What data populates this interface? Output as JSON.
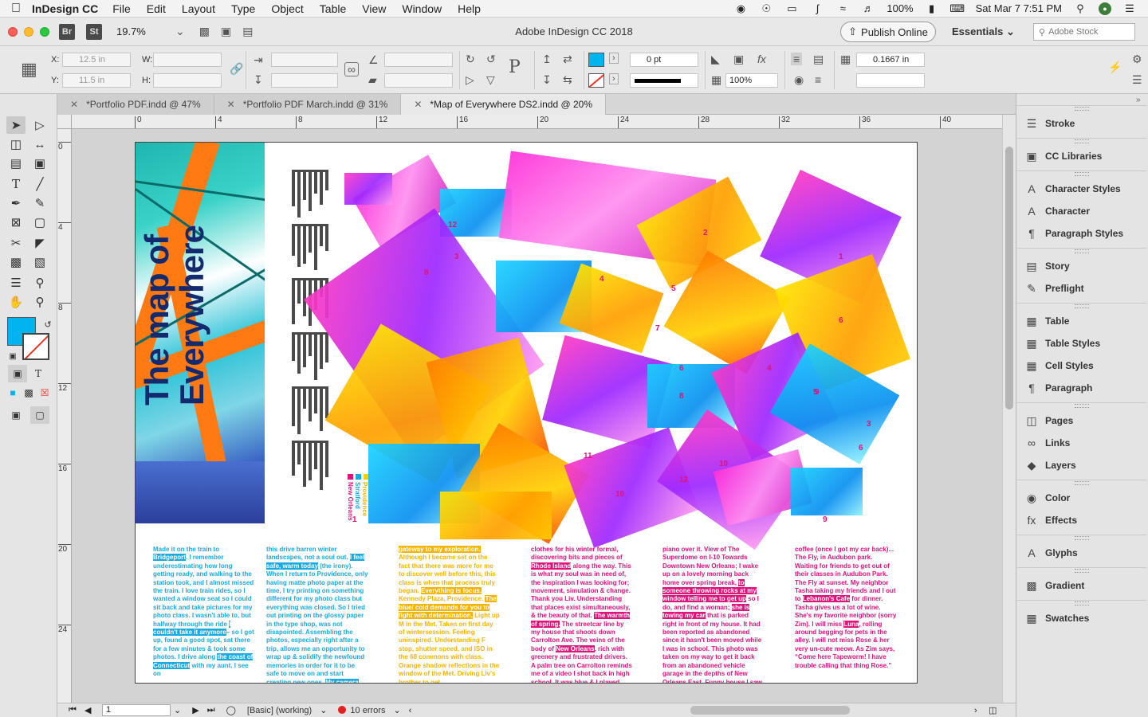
{
  "menubar": {
    "app": "InDesign CC",
    "menus": [
      "File",
      "Edit",
      "Layout",
      "Type",
      "Object",
      "Table",
      "View",
      "Window",
      "Help"
    ],
    "battery": "100%",
    "clock": "Sat Mar 7  7:51 PM"
  },
  "titlebar": {
    "title": "Adobe InDesign CC 2018",
    "zoom": "19.7%",
    "bridge": "Br",
    "stock_app": "St",
    "publish": "Publish Online",
    "workspace": "Essentials",
    "search_placeholder": "Adobe Stock"
  },
  "control": {
    "x_label": "X:",
    "x_value": "12.5 in",
    "y_label": "Y:",
    "y_value": "11.5 in",
    "w_label": "W:",
    "h_label": "H:",
    "stroke_weight": "0 pt",
    "opacity": "100%",
    "gutter": "0.1667 in"
  },
  "tabs": [
    {
      "label": "*Portfolio PDF.indd @ 47%"
    },
    {
      "label": "*Portfolio PDF March.indd @ 31%"
    },
    {
      "label": "*Map of Everywhere DS2.indd @ 20%"
    }
  ],
  "ruler": {
    "top": [
      "0",
      "4",
      "8",
      "12",
      "16",
      "20",
      "24",
      "28",
      "32",
      "36",
      "40"
    ],
    "left": [
      "0",
      "4",
      "8",
      "12",
      "16",
      "20",
      "24"
    ]
  },
  "document": {
    "cover_title_1": "The map of",
    "cover_title_2": "Everywhere",
    "legend": [
      "Providence",
      "Stratford",
      "New Orleans"
    ],
    "numbers": [
      "12",
      "3",
      "8",
      "2",
      "1",
      "4",
      "5",
      "7",
      "6",
      "4",
      "5",
      "6",
      "9",
      "11",
      "3",
      "6",
      "10",
      "12",
      "10",
      "9",
      "8",
      "1"
    ],
    "columns": [
      {
        "parts": [
          {
            "t": "Made it on the train to "
          },
          {
            "t": "Bridgeport",
            "h": true
          },
          {
            "t": ". I remember underestimating how long getting ready, and walking to the station took, and I almost missed the train. I love train rides, so I wanted a window seat so I could sit back and take pictures for my photo class. I wasn't able to, but halfway through the ride "
          },
          {
            "t": "I couldn't take it anymore",
            "h": true
          },
          {
            "t": "– so I got up, found a good spot, sat there for a few minutes & took some photos. I drive along "
          },
          {
            "t": "the coast of Connecticut",
            "h": true
          },
          {
            "t": " with my aunt. I see on"
          }
        ]
      },
      {
        "parts": [
          {
            "t": "this drive barren winter landscapes, not a soul out. "
          },
          {
            "t": "I feel safe, warm today",
            "h": true
          },
          {
            "t": " (the irony). When I return to Providence, only having matte photo paper at the time, I try printing on something different for my photo class but everything was closed. So I tried out printing on the glossy paper in the type shop, was not disapointed. Assembling the photos, especially right after a trip, allows me an opportunity to wrap up & solidify the newfound memories in order for it to be safe to move on and start creating new ones. "
          },
          {
            "t": "My camera was the",
            "h": true
          }
        ]
      },
      {
        "parts": [
          {
            "t": "gateway to my exploration.",
            "h": true
          },
          {
            "t": " Although I became set on the fact that there was more for me to discover well before this, this class is when that process truly began. "
          },
          {
            "t": "Everything is focus.",
            "h": true
          },
          {
            "t": " Kennedy Plaza, Providence. "
          },
          {
            "t": "The blue/ cold demands for you to fight with determination.",
            "h": true
          },
          {
            "t": " Light up M in the Met. Taken on first day of wintersession. Feeling uninspired. Understanding F stop, shutter speed, and ISO in the 68 commons with class. Orange shadow reflections in the window of the Met. Driving Liv's brother to get"
          }
        ]
      },
      {
        "parts": [
          {
            "t": "clothes for his winter formal, discovering bits and pieces of "
          },
          {
            "t": "Rhode Island",
            "h": true
          },
          {
            "t": " along the way. This is what my soul was in need of, the inspiration I was looking for; movement, simulation & change. Thank you Liv. Understanding that places exist simultaneously, & the beauty of that. "
          },
          {
            "t": "The warmth of spring.",
            "h": true
          },
          {
            "t": " The streetcar line by my house that shoots down Carrolton Ave. The veins of the body of "
          },
          {
            "t": "New Orleans",
            "h": true
          },
          {
            "t": ", rich with greenery and frustrated drivers. A palm tree on Carrolton reminds me of a video I shot back in high school. It was blue & I played"
          }
        ]
      },
      {
        "parts": [
          {
            "t": "piano over it. View of The Superdome on I-10 Towards Downtown New Orleans; I wake up on a lovely morning back home over spring break, "
          },
          {
            "t": "to someone throwing rocks at my window telling me to get up",
            "h": true
          },
          {
            "t": " so I do, and find a woman; "
          },
          {
            "t": "she is towing my car",
            "h": true
          },
          {
            "t": " that is parked right in front of my house. It had been reported as abandoned since it hasn't been moved while I was in school. This photo was taken on my way to get it back from an abandoned vehicle garage in the depths of New Orleans East. Funny house I saw after getting some"
          }
        ]
      },
      {
        "parts": [
          {
            "t": "coffee (once I got my car back)... The Fly, in Audubon park. Waiting for friends to get out of their classes in Audubon Park. The Fly at sunset. My neighbor Tasha taking my friends and I out to "
          },
          {
            "t": "Lebanon's Cafe",
            "h": true
          },
          {
            "t": " for dinner. Tasha gives us a lot of wine. She's my favorite neighbor (sorry Zim). I will miss "
          },
          {
            "t": "Luna",
            "h": true
          },
          {
            "t": ", rolling around begging for pets in the alley. I will not miss Rose & her very un-cute meow. As Zim says, “Come here Tapeworm! I have trouble calling that thing Rose.”"
          }
        ]
      }
    ]
  },
  "status": {
    "page": "1",
    "style": "[Basic] (working)",
    "errors": "10 errors"
  },
  "panels": [
    {
      "label": "Stroke",
      "icon": "stroke-icon"
    },
    {
      "label": "CC Libraries",
      "icon": "libraries-icon"
    },
    {
      "label": "Character Styles",
      "icon": "character-styles-icon"
    },
    {
      "label": "Character",
      "icon": "character-icon"
    },
    {
      "label": "Paragraph Styles",
      "icon": "paragraph-styles-icon"
    },
    {
      "label": "Story",
      "icon": "story-icon"
    },
    {
      "label": "Preflight",
      "icon": "preflight-icon"
    },
    {
      "label": "Table",
      "icon": "table-icon"
    },
    {
      "label": "Table Styles",
      "icon": "table-styles-icon"
    },
    {
      "label": "Cell Styles",
      "icon": "cell-styles-icon"
    },
    {
      "label": "Paragraph",
      "icon": "paragraph-icon"
    },
    {
      "label": "Pages",
      "icon": "pages-icon"
    },
    {
      "label": "Links",
      "icon": "links-icon"
    },
    {
      "label": "Layers",
      "icon": "layers-icon"
    },
    {
      "label": "Color",
      "icon": "color-icon"
    },
    {
      "label": "Effects",
      "icon": "effects-icon"
    },
    {
      "label": "Glyphs",
      "icon": "glyphs-icon"
    },
    {
      "label": "Gradient",
      "icon": "gradient-icon"
    },
    {
      "label": "Swatches",
      "icon": "swatches-icon"
    }
  ],
  "colors": {
    "fill": "#00b5ef",
    "cyan": "#1aa9e0",
    "magenta": "#e0127b",
    "yellow": "#f5b400"
  }
}
